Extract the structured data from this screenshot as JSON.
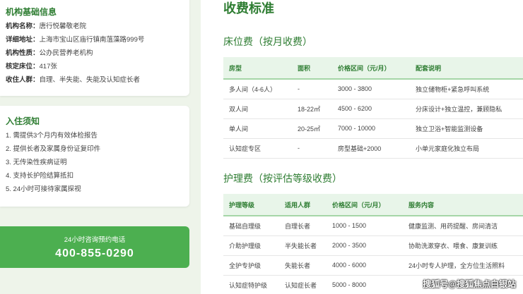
{
  "institution": {
    "title": "机构基础信息",
    "rows": [
      {
        "key": "机构名称：",
        "value": "唐行悦馨敬老院"
      },
      {
        "key": "详细地址：",
        "value": "上海市宝山区庙行镇南蕰藻路999号"
      },
      {
        "key": "机构性质：",
        "value": "公办民营养老机构"
      },
      {
        "key": "核定床位：",
        "value": "417张"
      },
      {
        "key": "收住人群：",
        "value": "自理、半失能、失能及认知症长者"
      }
    ]
  },
  "admission": {
    "title": "入住须知",
    "items": [
      "1. 需提供3个月内有效体检报告",
      "2. 提供长者及家属身份证复印件",
      "3. 无传染性疾病证明",
      "4. 支持长护险结算抵扣",
      "5. 24小时可接待家属探视"
    ]
  },
  "phone": {
    "label": "24小时咨询预约电话",
    "number": "400-855-0290"
  },
  "main": {
    "title": "收费标准",
    "bed_section": {
      "title": "床位费（按月收费）",
      "headers": [
        "房型",
        "面积",
        "价格区间（元/月）",
        "配套说明"
      ],
      "rows": [
        [
          "多人间（4-6人）",
          "-",
          "3000 - 3800",
          "独立储物柜+紧急呼叫系统"
        ],
        [
          "双人间",
          "18-22㎡",
          "4500 - 6200",
          "分床设计+独立温控，兼顾隐私"
        ],
        [
          "单人间",
          "20-25㎡",
          "7000 - 10000",
          "独立卫浴+智能监测设备"
        ],
        [
          "认知症专区",
          "-",
          "房型基础+2000",
          "小单元家庭化独立布局"
        ]
      ]
    },
    "care_section": {
      "title": "护理费（按评估等级收费）",
      "headers": [
        "护理等级",
        "适用人群",
        "价格区间（元/月）",
        "服务内容"
      ],
      "rows": [
        [
          "基础自理级",
          "自理长者",
          "1000 - 1500",
          "健康监测、用药提醒、房间清洁"
        ],
        [
          "介助护理级",
          "半失能长者",
          "2000 - 3500",
          "协助洗漱穿衣、喂食、康复训练"
        ],
        [
          "全护专护级",
          "失能长者",
          "4000 - 6000",
          "24小时专人护理，全方位生活照料"
        ],
        [
          "认知症特护级",
          "认知症长者",
          "5000 - 8000",
          ""
        ]
      ]
    }
  },
  "watermark": "搜狐号@搜狐焦点白银站",
  "colors": {
    "accent": "#2e7d32",
    "phone_bg": "#4caf50",
    "header_bg": "#e8f5e9",
    "page_bg": "#eef4ea"
  }
}
